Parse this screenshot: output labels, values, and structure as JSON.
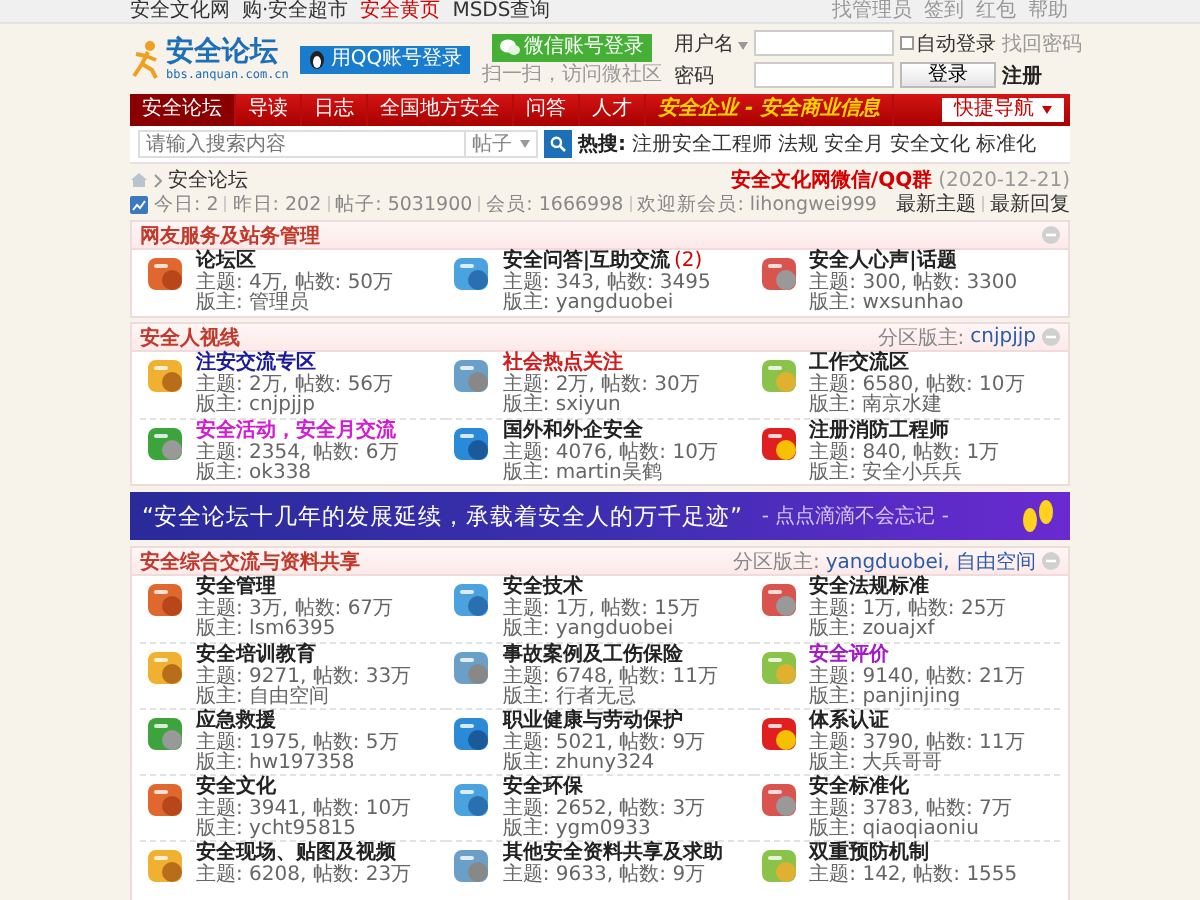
{
  "top_bar": {
    "left_links": [
      {
        "label": "安全文化网",
        "highlight": false
      },
      {
        "label": "购·安全超市",
        "highlight": false
      },
      {
        "label": "安全黄页",
        "highlight": true
      },
      {
        "label": "MSDS查询",
        "highlight": false
      }
    ],
    "right_links": [
      "找管理员",
      "签到",
      "红包",
      "帮助"
    ]
  },
  "header": {
    "logo_title": "安全论坛",
    "logo_url": "bbs.anquan.com.cn",
    "qq_login": "用QQ账号登录",
    "wechat_login": "微信账号登录",
    "wechat_hint": "扫一扫，访问微社区",
    "login": {
      "username_label": "用户名",
      "auto_login": {
        "label": "自动登录",
        "checked": false
      },
      "forgot": "找回密码",
      "password_label": "密码",
      "submit": "登录",
      "register": "注册"
    }
  },
  "nav": {
    "items": [
      {
        "label": "安全论坛",
        "selected": true,
        "kind": "link"
      },
      {
        "label": "导读",
        "selected": false,
        "kind": "link"
      },
      {
        "label": "日志",
        "selected": false,
        "kind": "link"
      },
      {
        "label": "全国地方安全",
        "selected": false,
        "kind": "link"
      },
      {
        "label": "问答",
        "selected": false,
        "kind": "link"
      },
      {
        "label": "人才",
        "selected": false,
        "kind": "link"
      },
      {
        "label": "安全企业 - 安全商业信息",
        "selected": false,
        "kind": "promo"
      }
    ],
    "quick_nav": "快捷导航"
  },
  "search": {
    "placeholder": "请输入搜索内容",
    "scope": "帖子",
    "hot_label": "热搜:",
    "hot_links": [
      "注册安全工程师",
      "法规",
      "安全月",
      "安全文化",
      "标准化"
    ]
  },
  "breadcrumb": {
    "current": "安全论坛",
    "notice": "安全文化网微信/QQ群",
    "date": "(2020-12-21)"
  },
  "stats": {
    "items": [
      "今日: 2",
      "昨日: 202",
      "帖子: 5031900",
      "会员: 1666998",
      "欢迎新会员: lihongwei999"
    ],
    "links": [
      "最新主题",
      "最新回复"
    ]
  },
  "blocks": [
    {
      "kind": "section",
      "title": "网友服务及站务管理",
      "expanded": true,
      "forums": [
        {
          "title": "论坛区",
          "color": "#222222",
          "stats": "主题: 4万, 帖数: 50万",
          "moderator": "版主: 管理员"
        },
        {
          "title": "安全问答|互助交流",
          "color": "#222222",
          "new_posts": "(2)",
          "stats": "主题: 343, 帖数: 3495",
          "moderator": "版主: yangduobei"
        },
        {
          "title": "安全人心声|话题",
          "color": "#222222",
          "stats": "主题: 300, 帖数: 3300",
          "moderator": "版主: wxsunhao"
        }
      ]
    },
    {
      "kind": "section",
      "title": "安全人视线",
      "moderators_label": "分区版主:",
      "moderators": "cnjpjjp",
      "expanded": true,
      "forums": [
        {
          "title": "注安交流专区",
          "color": "#1a1a9c",
          "stats": "主题: 2万, 帖数: 56万",
          "moderator": "版主: cnjpjjp"
        },
        {
          "title": "社会热点关注",
          "color": "#d41b1b",
          "stats": "主题: 2万, 帖数: 30万",
          "moderator": "版主: sxiyun"
        },
        {
          "title": "工作交流区",
          "color": "#222222",
          "stats": "主题: 6580, 帖数: 10万",
          "moderator": "版主: 南京水建"
        },
        {
          "title": "安全活动，安全月交流",
          "color": "#d21bd2",
          "stats": "主题: 2354, 帖数: 6万",
          "moderator": "版主: ok338"
        },
        {
          "title": "国外和外企安全",
          "color": "#222222",
          "stats": "主题: 4076, 帖数: 10万",
          "moderator": "版主: martin吴鹤"
        },
        {
          "title": "注册消防工程师",
          "color": "#222222",
          "stats": "主题: 840, 帖数: 1万",
          "moderator": "版主: 安全小兵兵"
        }
      ]
    },
    {
      "kind": "banner",
      "quote": "“安全论坛十几年的发展延续，承载着安全人的万千足迹”",
      "tagline": "- 点点滴滴不会忘记 -"
    },
    {
      "kind": "section",
      "title": "安全综合交流与资料共享",
      "moderators_label": "分区版主:",
      "moderators": "yangduobei, 自由空间",
      "expanded": true,
      "forums": [
        {
          "title": "安全管理",
          "color": "#222222",
          "stats": "主题: 3万, 帖数: 67万",
          "moderator": "版主: lsm6395"
        },
        {
          "title": "安全技术",
          "color": "#222222",
          "stats": "主题: 1万, 帖数: 15万",
          "moderator": "版主: yangduobei"
        },
        {
          "title": "安全法规标准",
          "color": "#222222",
          "stats": "主题: 1万, 帖数: 25万",
          "moderator": "版主: zouajxf"
        },
        {
          "title": "安全培训教育",
          "color": "#222222",
          "stats": "主题: 9271, 帖数: 33万",
          "moderator": "版主: 自由空间"
        },
        {
          "title": "事故案例及工伤保险",
          "color": "#222222",
          "stats": "主题: 6748, 帖数: 11万",
          "moderator": "版主: 行者无忌"
        },
        {
          "title": "安全评价",
          "color": "#a21bc4",
          "stats": "主题: 9140, 帖数: 21万",
          "moderator": "版主: panjinjing"
        },
        {
          "title": "应急救援",
          "color": "#222222",
          "stats": "主题: 1975, 帖数: 5万",
          "moderator": "版主: hw197358"
        },
        {
          "title": "职业健康与劳动保护",
          "color": "#222222",
          "stats": "主题: 5021, 帖数: 9万",
          "moderator": "版主: zhuny324"
        },
        {
          "title": "体系认证",
          "color": "#222222",
          "stats": "主题: 3790, 帖数: 11万",
          "moderator": "版主: 大兵哥哥"
        },
        {
          "title": "安全文化",
          "color": "#222222",
          "stats": "主题: 3941, 帖数: 10万",
          "moderator": "版主: ycht95815"
        },
        {
          "title": "安全环保",
          "color": "#222222",
          "stats": "主题: 2652, 帖数: 3万",
          "moderator": "版主: ygm0933"
        },
        {
          "title": "安全标准化",
          "color": "#222222",
          "stats": "主题: 3783, 帖数: 7万",
          "moderator": "版主: qiaoqiaoniu"
        },
        {
          "title": "安全现场、贴图及视频",
          "color": "#222222",
          "stats": "主题: 6208, 帖数: 23万"
        },
        {
          "title": "其他安全资料共享及求助",
          "color": "#222222",
          "stats": "主题: 9633, 帖数: 9万"
        },
        {
          "title": "双重预防机制",
          "color": "#222222",
          "stats": "主题: 142, 帖数: 1555"
        }
      ]
    }
  ]
}
